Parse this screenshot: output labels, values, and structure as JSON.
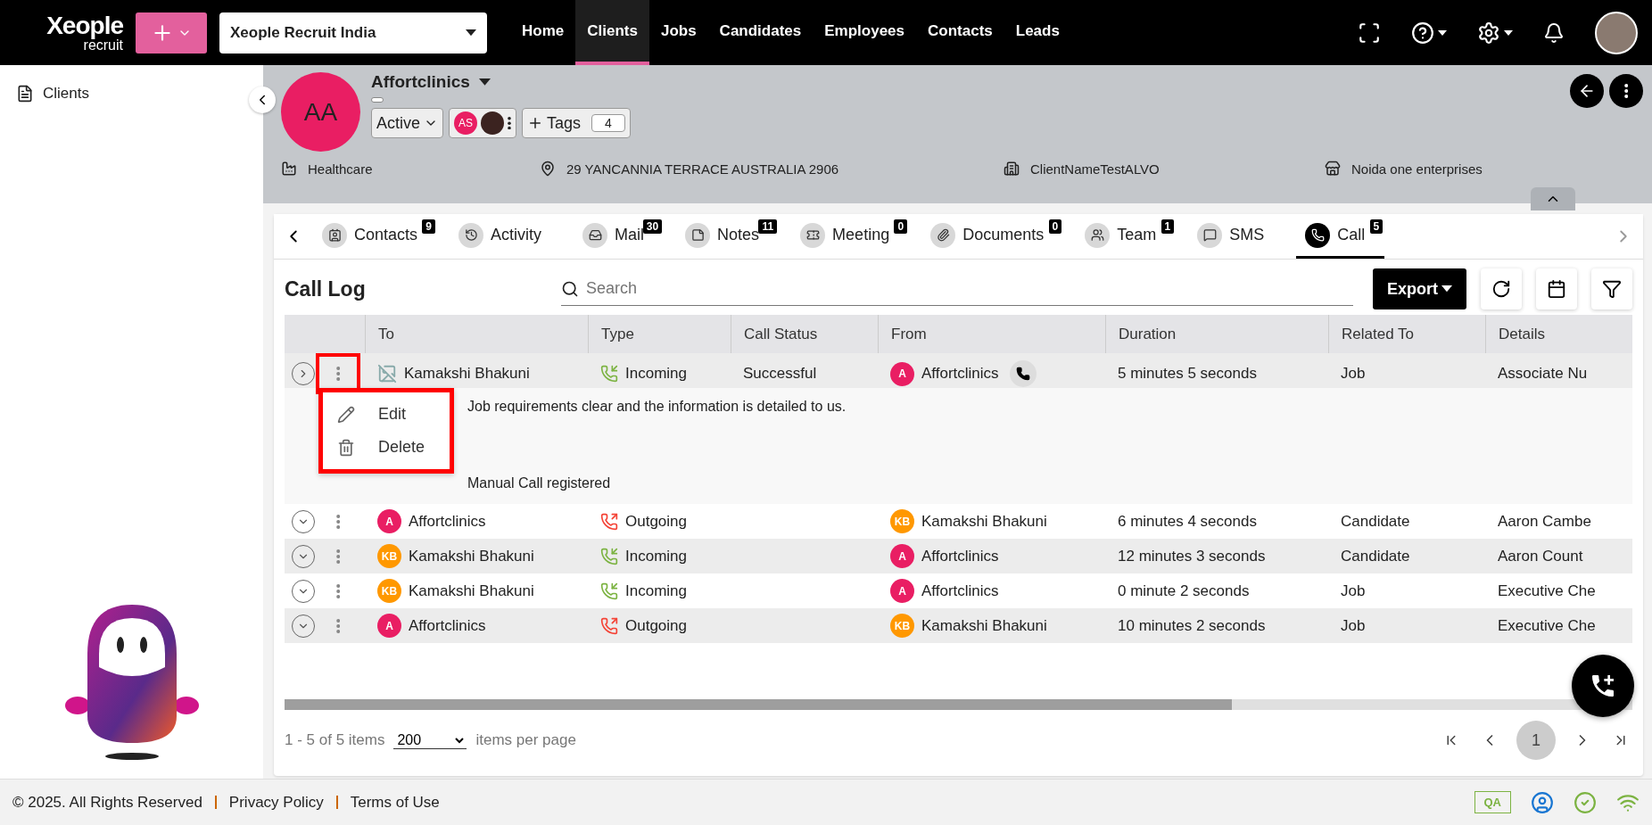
{
  "brand": {
    "name": "Xeople",
    "sub": "recruit"
  },
  "workspace": {
    "value": "Xeople Recruit India"
  },
  "nav": [
    {
      "label": "Home",
      "selected": false
    },
    {
      "label": "Clients",
      "selected": true
    },
    {
      "label": "Jobs",
      "selected": false
    },
    {
      "label": "Candidates",
      "selected": false
    },
    {
      "label": "Employees",
      "selected": false
    },
    {
      "label": "Contacts",
      "selected": false
    },
    {
      "label": "Leads",
      "selected": false
    }
  ],
  "sidebar": {
    "items": [
      {
        "label": "Clients"
      }
    ]
  },
  "client": {
    "initials": "AA",
    "name": "Affortclinics",
    "status": "Active",
    "owner_initials": "AS",
    "tags_label": "Tags",
    "tags_count": "4",
    "info": [
      {
        "kind": "industry",
        "text": "Healthcare"
      },
      {
        "kind": "address",
        "text": "29 YANCANNIA TERRACE AUSTRALIA 2906"
      },
      {
        "kind": "company",
        "text": "ClientNameTestALVO"
      },
      {
        "kind": "store",
        "text": "Noida one enterprises"
      }
    ]
  },
  "tabs": [
    {
      "label": "Contacts",
      "count": "9",
      "selected": false
    },
    {
      "label": "Activity",
      "selected": false
    },
    {
      "label": "Mail",
      "count": "30",
      "selected": false
    },
    {
      "label": "Notes",
      "count": "11",
      "selected": false
    },
    {
      "label": "Meeting",
      "count": "0",
      "selected": false
    },
    {
      "label": "Documents",
      "count": "0",
      "selected": false
    },
    {
      "label": "Team",
      "count": "1",
      "selected": false
    },
    {
      "label": "SMS",
      "selected": false
    },
    {
      "label": "Call",
      "count": "5",
      "selected": true
    }
  ],
  "call_log": {
    "title": "Call Log",
    "search": {
      "placeholder": "Search"
    },
    "export_label": "Export",
    "columns": [
      "To",
      "Type",
      "Call Status",
      "From",
      "Duration",
      "Related To",
      "Details"
    ],
    "rows": [
      {
        "expanded": true,
        "to": {
          "name": "Kamakshi Bhakuni",
          "kind": "image"
        },
        "type": {
          "label": "Incoming",
          "kind": "incoming"
        },
        "status": "Successful",
        "from": {
          "name": "Affortclinics",
          "initials": "A",
          "color": "#e91e63",
          "call_button": true
        },
        "duration": "5 minutes 5 seconds",
        "related": "Job",
        "details": "Associate Nu",
        "detail_lines": [
          "Job requirements clear and the information is detailed to us.",
          "Manual Call registered"
        ]
      },
      {
        "expanded": false,
        "to": {
          "name": "Affortclinics",
          "initials": "A",
          "color": "#e91e63"
        },
        "type": {
          "label": "Outgoing",
          "kind": "outgoing"
        },
        "status": "",
        "from": {
          "name": "Kamakshi Bhakuni",
          "initials": "KB",
          "color": "#ff9800",
          "call_button": false
        },
        "duration": "6 minutes 4 seconds",
        "related": "Candidate",
        "details": "Aaron Cambe"
      },
      {
        "expanded": false,
        "to": {
          "name": "Kamakshi Bhakuni",
          "initials": "KB",
          "color": "#ff9800"
        },
        "type": {
          "label": "Incoming",
          "kind": "incoming"
        },
        "status": "",
        "from": {
          "name": "Affortclinics",
          "initials": "A",
          "color": "#e91e63",
          "call_button": false
        },
        "duration": "12 minutes 3 seconds",
        "related": "Candidate",
        "details": "Aaron Count"
      },
      {
        "expanded": false,
        "to": {
          "name": "Kamakshi Bhakuni",
          "initials": "KB",
          "color": "#ff9800"
        },
        "type": {
          "label": "Incoming",
          "kind": "incoming"
        },
        "status": "",
        "from": {
          "name": "Affortclinics",
          "initials": "A",
          "color": "#e91e63",
          "call_button": false
        },
        "duration": "0 minute 2 seconds",
        "related": "Job",
        "details": "Executive Che"
      },
      {
        "expanded": false,
        "to": {
          "name": "Affortclinics",
          "initials": "A",
          "color": "#e91e63"
        },
        "type": {
          "label": "Outgoing",
          "kind": "outgoing"
        },
        "status": "",
        "from": {
          "name": "Kamakshi Bhakuni",
          "initials": "KB",
          "color": "#ff9800",
          "call_button": false
        },
        "duration": "10 minutes 2 seconds",
        "related": "Job",
        "details": "Executive Che"
      }
    ],
    "row_menu": {
      "items": [
        {
          "kind": "edit",
          "label": "Edit"
        },
        {
          "kind": "delete",
          "label": "Delete"
        }
      ]
    },
    "pagination": {
      "summary": "1 - 5 of 5 items",
      "per_page": "200",
      "per_page_label": "items per page",
      "pages": [
        {
          "label": "1",
          "selected": true
        }
      ]
    }
  },
  "footer": {
    "copyright": "© 2025. All Rights Reserved",
    "links": [
      "Privacy Policy",
      "Terms of Use"
    ],
    "env_badge": "QA"
  }
}
